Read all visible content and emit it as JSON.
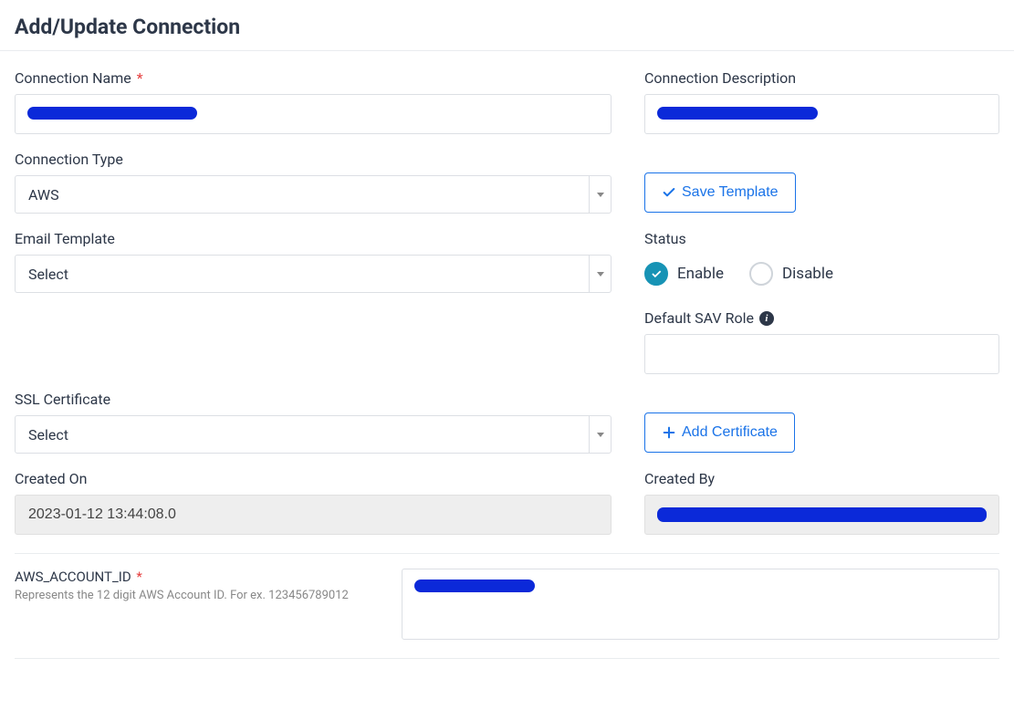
{
  "page_title": "Add/Update Connection",
  "fields": {
    "connection_name": {
      "label": "Connection Name",
      "required": true,
      "value": ""
    },
    "connection_description": {
      "label": "Connection Description",
      "value": ""
    },
    "connection_type": {
      "label": "Connection Type",
      "value": "AWS"
    },
    "email_template": {
      "label": "Email Template",
      "value": "Select"
    },
    "ssl_certificate": {
      "label": "SSL Certificate",
      "value": "Select"
    },
    "status": {
      "label": "Status",
      "enable": "Enable",
      "disable": "Disable",
      "selected": "enable"
    },
    "default_sav_role": {
      "label": "Default SAV Role",
      "value": ""
    },
    "created_on": {
      "label": "Created On",
      "value": "2023-01-12 13:44:08.0"
    },
    "created_by": {
      "label": "Created By",
      "value": ""
    },
    "aws_account_id": {
      "label": "AWS_ACCOUNT_ID",
      "required": true,
      "help": "Represents the 12 digit AWS Account ID. For ex. 123456789012",
      "value": ""
    }
  },
  "buttons": {
    "save_template": "Save Template",
    "add_certificate": "Add Certificate"
  },
  "icons": {
    "info": "i"
  }
}
